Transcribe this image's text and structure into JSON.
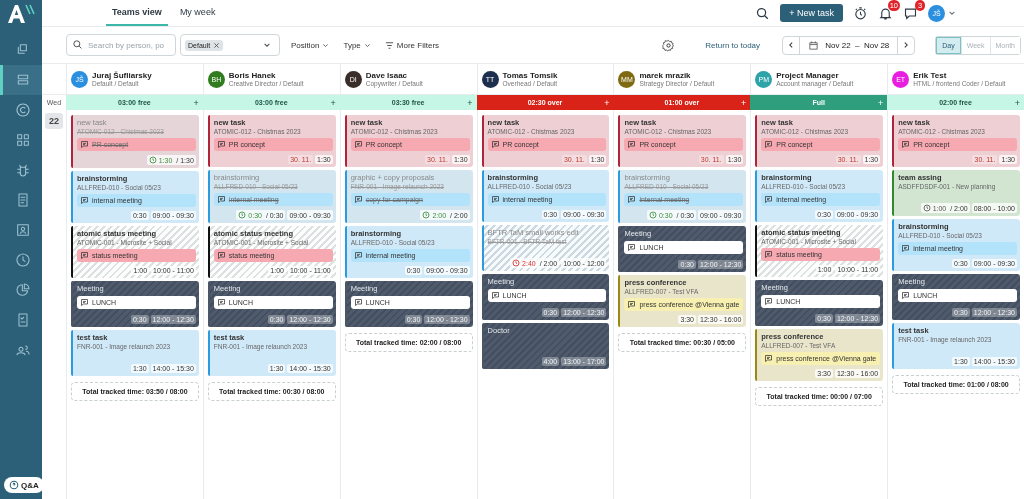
{
  "sidebar": {
    "items": [
      {
        "kind": "copy",
        "selected": false
      },
      {
        "kind": "stack",
        "selected": true
      },
      {
        "kind": "coin",
        "selected": false
      },
      {
        "kind": "grid",
        "selected": false
      },
      {
        "kind": "bug",
        "selected": false
      },
      {
        "kind": "document",
        "selected": false
      },
      {
        "kind": "person",
        "selected": false
      },
      {
        "kind": "clock",
        "selected": false
      },
      {
        "kind": "pie",
        "selected": false
      },
      {
        "kind": "checklist",
        "selected": false
      },
      {
        "kind": "people",
        "selected": false
      }
    ],
    "help": "Q&A"
  },
  "tabs": [
    {
      "label": "Teams view",
      "selected": true
    },
    {
      "label": "My week",
      "selected": false
    }
  ],
  "top_actions": {
    "new_task": "+ New task",
    "notifications": "10",
    "messages": "3",
    "user": "JŠ"
  },
  "filters": {
    "search_placeholder": "Search by person, po",
    "tag": "Default",
    "position": "Position",
    "type": "Type",
    "more": "More Filters"
  },
  "navigation": {
    "return": "Return to today",
    "range": "Nov 22  –  Nov 28",
    "views": [
      {
        "label": "Day",
        "selected": true
      },
      {
        "label": "Week",
        "selected": false
      },
      {
        "label": "Month",
        "selected": false
      }
    ]
  },
  "day": {
    "weekday": "Wed",
    "date": "22"
  },
  "people": [
    {
      "initials": "JŠ",
      "color": "#2b8fe0",
      "name": "Juraj Šufliarsky",
      "role": "Default / Default",
      "capacity": {
        "text": "03:00 free",
        "kind": "free",
        "add": "+"
      },
      "total": "Total tracked time: 03:50 / 08:00",
      "cards": [
        {
          "kind": "done",
          "color": "#b0243a",
          "title": "new task",
          "project": "ATOMIC-012 - Chistmas 2023",
          "note": {
            "text": "PR concept",
            "color": "#f6a9b1"
          },
          "tracked": {
            "spent": "1:30",
            "planned": "/ 1:30",
            "kind": "ok"
          }
        },
        {
          "kind": "task",
          "color": "#2b9be0",
          "title": "brainstorming",
          "project": "ALLFRED-010 - Social 05/23",
          "note": {
            "text": "internal meeting",
            "color": "#b2e3fb"
          },
          "duration": "0:30",
          "range": "09:00 - 09:30"
        },
        {
          "kind": "pattern",
          "color": "#111111",
          "title": "atomic status meeting",
          "project": "ATOMIC-001 - Microsite + Social",
          "note": {
            "text": "status meeting",
            "color": "#f6a9b1"
          },
          "duration": "1:00",
          "range": "10:00 - 11:00"
        },
        {
          "kind": "absence",
          "color": "#4a5566",
          "title": "Meeting",
          "note": {
            "text": "LUNCH",
            "color": "#ffffff"
          },
          "duration": "0:30",
          "range": "12:00 - 12:30"
        },
        {
          "kind": "task",
          "color": "#2b9be0",
          "title": "test task",
          "project": "FNR-001 - Image relaunch 2023",
          "duration": "1:30",
          "range": "14:00 - 15:30"
        }
      ]
    },
    {
      "initials": "BH",
      "color": "#2f7d1f",
      "name": "Boris Hanek",
      "role": "Creative Director / Default",
      "capacity": {
        "text": "03:00 free",
        "kind": "free",
        "add": "+"
      },
      "total": "Total tracked time: 00:30 / 08:00",
      "cards": [
        {
          "kind": "task",
          "color": "#b0243a",
          "title": "new task",
          "project": "ATOMIC-012 - Chistmas 2023",
          "note": {
            "text": "PR concept",
            "color": "#f6a9b1"
          },
          "due": "30. 11.",
          "duration": "1:30"
        },
        {
          "kind": "done",
          "color": "#2b9be0",
          "title": "brainstorming",
          "project": "ALLFRED-010 - Social 05/23",
          "note": {
            "text": "internal meeting",
            "color": "#b2e3fb"
          },
          "tracked": {
            "spent": "0:30",
            "planned": "/ 0:30",
            "kind": "ok"
          },
          "range": "09:00 - 09:30"
        },
        {
          "kind": "pattern",
          "color": "#111111",
          "title": "atomic status meeting",
          "project": "ATOMIC-001 - Microsite + Social",
          "note": {
            "text": "status meeting",
            "color": "#f6a9b1"
          },
          "duration": "1:00",
          "range": "10:00 - 11:00"
        },
        {
          "kind": "absence",
          "color": "#4a5566",
          "title": "Meeting",
          "note": {
            "text": "LUNCH",
            "color": "#ffffff"
          },
          "duration": "0:30",
          "range": "12:00 - 12:30"
        },
        {
          "kind": "task",
          "color": "#2b9be0",
          "title": "test task",
          "project": "FNR-001 - Image relaunch 2023",
          "duration": "1:30",
          "range": "14:00 - 15:30"
        }
      ]
    },
    {
      "initials": "DI",
      "color": "#3a2e2a",
      "name": "Dave Isaac",
      "role": "Copywriter / Default",
      "capacity": {
        "text": "03:30 free",
        "kind": "free",
        "add": "+"
      },
      "total": "Total tracked time: 02:00 / 08:00",
      "cards": [
        {
          "kind": "task",
          "color": "#b0243a",
          "title": "new task",
          "project": "ATOMIC-012 - Chistmas 2023",
          "note": {
            "text": "PR concept",
            "color": "#f6a9b1"
          },
          "due": "30. 11.",
          "duration": "1:30"
        },
        {
          "kind": "done",
          "color": "#2b9be0",
          "title": "graphic + copy proposals",
          "project": "FNR-001 - Image relaunch 2023",
          "note": {
            "text": "copy for campaign",
            "color": "#b2e3fb"
          },
          "tracked": {
            "spent": "2:00",
            "planned": "/ 2:00",
            "kind": "ok"
          }
        },
        {
          "kind": "task",
          "color": "#2b9be0",
          "title": "brainstorming",
          "project": "ALLFRED-010 - Social 05/23",
          "note": {
            "text": "internal meeting",
            "color": "#b2e3fb"
          },
          "duration": "0:30",
          "range": "09:00 - 09:30"
        },
        {
          "kind": "absence",
          "color": "#4a5566",
          "title": "Meeting",
          "note": {
            "text": "LUNCH",
            "color": "#ffffff"
          },
          "duration": "0:30",
          "range": "12:00 - 12:30"
        }
      ]
    },
    {
      "initials": "TT",
      "color": "#1d2f4f",
      "name": "Tomas Tomsik",
      "role": "Overhead / Default",
      "capacity": {
        "text": "02:30 over",
        "kind": "over",
        "add": "+"
      },
      "cards": [
        {
          "kind": "task",
          "color": "#b0243a",
          "title": "new task",
          "project": "ATOMIC-012 - Chistmas 2023",
          "note": {
            "text": "PR concept",
            "color": "#f6a9b1"
          },
          "due": "30. 11.",
          "duration": "1:30"
        },
        {
          "kind": "task",
          "color": "#2b9be0",
          "title": "brainstorming",
          "project": "ALLFRED-010 - Social 05/23",
          "note": {
            "text": "internal meeting",
            "color": "#b2e3fb"
          },
          "duration": "0:30",
          "range": "09:00 - 09:30"
        },
        {
          "kind": "done_pattern",
          "color": "#2b9be0",
          "title": "BFTR TaM small works edit",
          "project": "BFTR-001 - BFTR TaM test",
          "tracked": {
            "spent": "2:40",
            "planned": "/ 2:00",
            "kind": "over"
          },
          "range": "10:00 - 12:00"
        },
        {
          "kind": "absence",
          "color": "#4a5566",
          "title": "Meeting",
          "note": {
            "text": "LUNCH",
            "color": "#ffffff"
          },
          "duration": "0:30",
          "range": "12:00 - 12:30"
        },
        {
          "kind": "absence",
          "color": "#4a5566",
          "title": "Doctor",
          "duration": "4:00",
          "range": "13:00 - 17:00"
        }
      ]
    },
    {
      "initials": "MM",
      "color": "#7d6a12",
      "name": "marek mrazik",
      "role": "Strategy Director / Default",
      "capacity": {
        "text": "01:00 over",
        "kind": "over",
        "add": "+"
      },
      "total": "Total tracked time: 00:30 / 05:00",
      "cards": [
        {
          "kind": "task",
          "color": "#b0243a",
          "title": "new task",
          "project": "ATOMIC-012 - Chistmas 2023",
          "note": {
            "text": "PR concept",
            "color": "#f6a9b1"
          },
          "due": "30. 11.",
          "duration": "1:30"
        },
        {
          "kind": "done",
          "color": "#2b9be0",
          "title": "brainstorming",
          "project": "ALLFRED-010 - Social 05/23",
          "note": {
            "text": "internal meeting",
            "color": "#b2e3fb"
          },
          "tracked": {
            "spent": "0:30",
            "planned": "/ 0:30",
            "kind": "ok"
          },
          "range": "09:00 - 09:30"
        },
        {
          "kind": "absence",
          "color": "#4a5566",
          "title": "Meeting",
          "note": {
            "text": "LUNCH",
            "color": "#ffffff"
          },
          "duration": "0:30",
          "range": "12:00 - 12:30"
        },
        {
          "kind": "task",
          "color": "#9a8a14",
          "title": "press conference",
          "project": "ALLFRED-007 - Test VFA",
          "note": {
            "text": "press conference @Vienna gate",
            "color": "#f8f0b0"
          },
          "duration": "3:30",
          "range": "12:30 - 16:00"
        }
      ]
    },
    {
      "initials": "PM",
      "color": "#2ea3a8",
      "name": "Project Manager",
      "role": "Account manager / Default",
      "capacity": {
        "text": "Full",
        "kind": "full",
        "add": "+"
      },
      "total": "Total tracked time: 00:00 / 07:00",
      "cards": [
        {
          "kind": "task",
          "color": "#b0243a",
          "title": "new task",
          "project": "ATOMIC-012 - Chistmas 2023",
          "note": {
            "text": "PR concept",
            "color": "#f6a9b1"
          },
          "due": "30. 11.",
          "duration": "1:30"
        },
        {
          "kind": "task",
          "color": "#2b9be0",
          "title": "brainstorming",
          "project": "ALLFRED-010 - Social 05/23",
          "note": {
            "text": "internal meeting",
            "color": "#b2e3fb"
          },
          "duration": "0:30",
          "range": "09:00 - 09:30"
        },
        {
          "kind": "pattern",
          "color": "#111111",
          "title": "atomic status meeting",
          "project": "ATOMIC-001 - Microsite + Social",
          "note": {
            "text": "status meeting",
            "color": "#f6a9b1"
          },
          "duration": "1:00",
          "range": "10:00 - 11:00"
        },
        {
          "kind": "absence",
          "color": "#4a5566",
          "title": "Meeting",
          "note": {
            "text": "LUNCH",
            "color": "#ffffff"
          },
          "duration": "0:30",
          "range": "12:00 - 12:30"
        },
        {
          "kind": "task",
          "color": "#9a8a14",
          "title": "press conference",
          "project": "ALLFRED-007 - Test VFA",
          "note": {
            "text": "press conference @Vienna gate",
            "color": "#f8f0b0"
          },
          "duration": "3:30",
          "range": "12:30 - 16:00"
        }
      ]
    },
    {
      "initials": "ET",
      "color": "#e81ee0",
      "name": "Erik Test",
      "role": "HTML / frontend Coder / Default",
      "capacity": {
        "text": "02:00 free",
        "kind": "free",
        "add": "+"
      },
      "total": "Total tracked time: 01:00 / 08:00",
      "cards": [
        {
          "kind": "task",
          "color": "#b0243a",
          "title": "new task",
          "project": "ATOMIC-012 - Chistmas 2023",
          "note": {
            "text": "PR concept",
            "color": "#f6a9b1"
          },
          "due": "30. 11.",
          "duration": "1:30"
        },
        {
          "kind": "task",
          "color": "#2f8a2f",
          "title": "team assing",
          "project": "ASDFFDSDF-001 - New planning",
          "tracked": {
            "spent": "1:00",
            "planned": "/ 2:00",
            "kind": "neutral"
          },
          "range": "08:00 - 10:00"
        },
        {
          "kind": "task",
          "color": "#2b9be0",
          "title": "brainstorming",
          "project": "ALLFRED-010 - Social 05/23",
          "note": {
            "text": "internal meeting",
            "color": "#b2e3fb"
          },
          "duration": "0:30",
          "range": "09:00 - 09:30"
        },
        {
          "kind": "absence",
          "color": "#4a5566",
          "title": "Meeting",
          "note": {
            "text": "LUNCH",
            "color": "#ffffff"
          },
          "duration": "0:30",
          "range": "12:00 - 12:30"
        },
        {
          "kind": "task",
          "color": "#2b9be0",
          "title": "test task",
          "project": "FNR-001 - Image relaunch 2023",
          "duration": "1:30",
          "range": "14:00 - 15:30"
        }
      ]
    }
  ]
}
